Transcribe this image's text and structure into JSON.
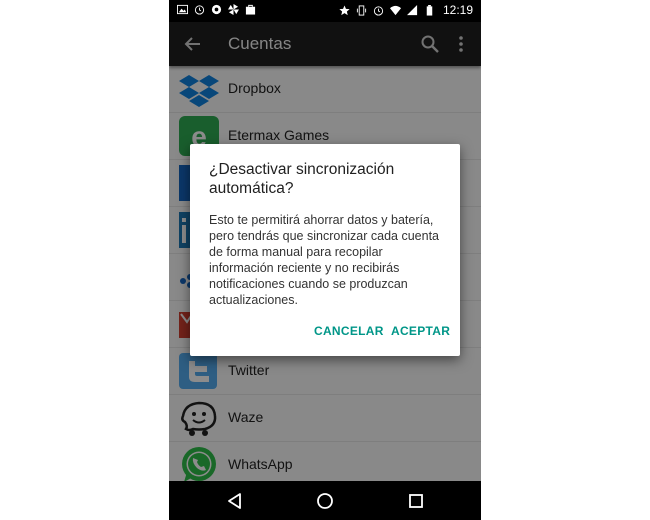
{
  "status_bar": {
    "time": "12:19"
  },
  "toolbar": {
    "title": "Cuentas"
  },
  "accounts": [
    {
      "name": "Dropbox",
      "icon": "dropbox-icon"
    },
    {
      "name": "Etermax Games",
      "icon": "etermax-icon"
    },
    {
      "name": "",
      "icon": "account-icon-3"
    },
    {
      "name": "",
      "icon": "linkedin-icon"
    },
    {
      "name": "",
      "icon": "account-icon-5"
    },
    {
      "name": "",
      "icon": "gmail-icon"
    },
    {
      "name": "Twitter",
      "icon": "twitter-icon"
    },
    {
      "name": "Waze",
      "icon": "waze-icon"
    },
    {
      "name": "WhatsApp",
      "icon": "whatsapp-icon"
    }
  ],
  "dialog": {
    "title": "¿Desactivar sincronización automática?",
    "body": "Esto te permitirá ahorrar datos y batería, pero tendrás que sincronizar cada cuenta de forma manual para recopilar información reciente y no recibirás notificaciones cuando se produzcan actualizaciones.",
    "cancel_label": "CANCELAR",
    "accept_label": "ACEPTAR"
  },
  "colors": {
    "accent": "#009688",
    "toolbar": "#202020"
  }
}
